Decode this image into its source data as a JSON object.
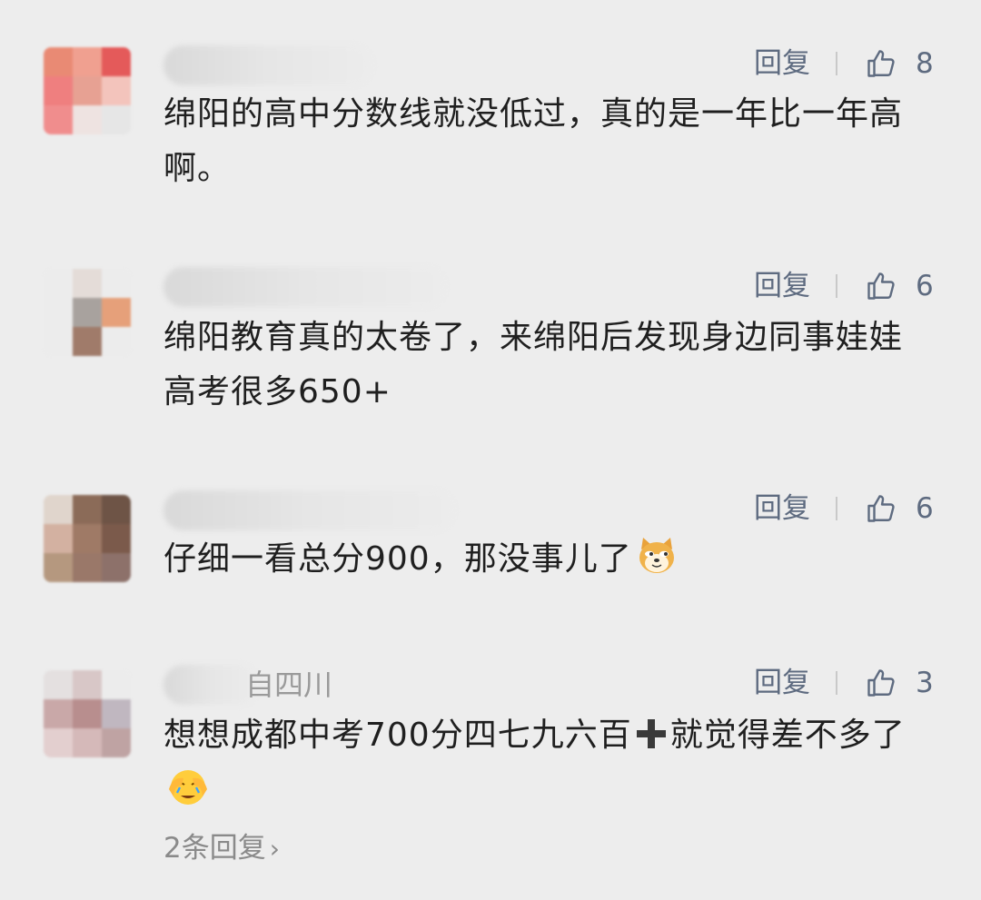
{
  "comments": [
    {
      "reply_label": "回复",
      "likes": "8",
      "text": "绵阳的高中分数线就没低过，真的是一年比一年高啊。",
      "avatar_colors": [
        "#e98a74",
        "#f0a090",
        "#e45a5a",
        "#ef7f7f",
        "#e7a193",
        "#f3c4bc",
        "#f08d8d",
        "#eee3e1",
        "#e6e6e6"
      ]
    },
    {
      "reply_label": "回复",
      "likes": "6",
      "text": "绵阳教育真的太卷了，来绵阳后发现身边同事娃娃高考很多650+",
      "avatar_colors": [
        "#ececec",
        "#e4dcd8",
        "#ececec",
        "#ececec",
        "#a8a29e",
        "#e6a07a",
        "#ececec",
        "#a07b6a",
        "#ececec"
      ]
    },
    {
      "reply_label": "回复",
      "likes": "6",
      "text_before_emoji": "仔细一看总分900，那没事儿了",
      "emoji_name": "doge-emoji",
      "avatar_colors": [
        "#e0d5cc",
        "#8b6b58",
        "#6e5446",
        "#d3b1a1",
        "#9f7a66",
        "#7b5a4b",
        "#b5987f",
        "#9a7869",
        "#8d716a"
      ]
    },
    {
      "username_tail": "自四川",
      "reply_label": "回复",
      "likes": "3",
      "text_part1": "想想成都中考700分四七九六百",
      "plus_icon": "heavy-plus-icon",
      "text_part2": "就觉得差不多了",
      "emoji_name": "facepalm-emoji",
      "avatar_colors": [
        "#e4e0e0",
        "#d8c7c7",
        "#ececec",
        "#c9a8a8",
        "#b88e8e",
        "#c0b7c0",
        "#e3cfcf",
        "#d5b9b9",
        "#bfa3a3"
      ]
    }
  ],
  "more_replies": "2条回复",
  "colors": {
    "background": "#ededed",
    "action_blue": "#5e6b80",
    "secondary_gray": "#8a8a8a"
  }
}
